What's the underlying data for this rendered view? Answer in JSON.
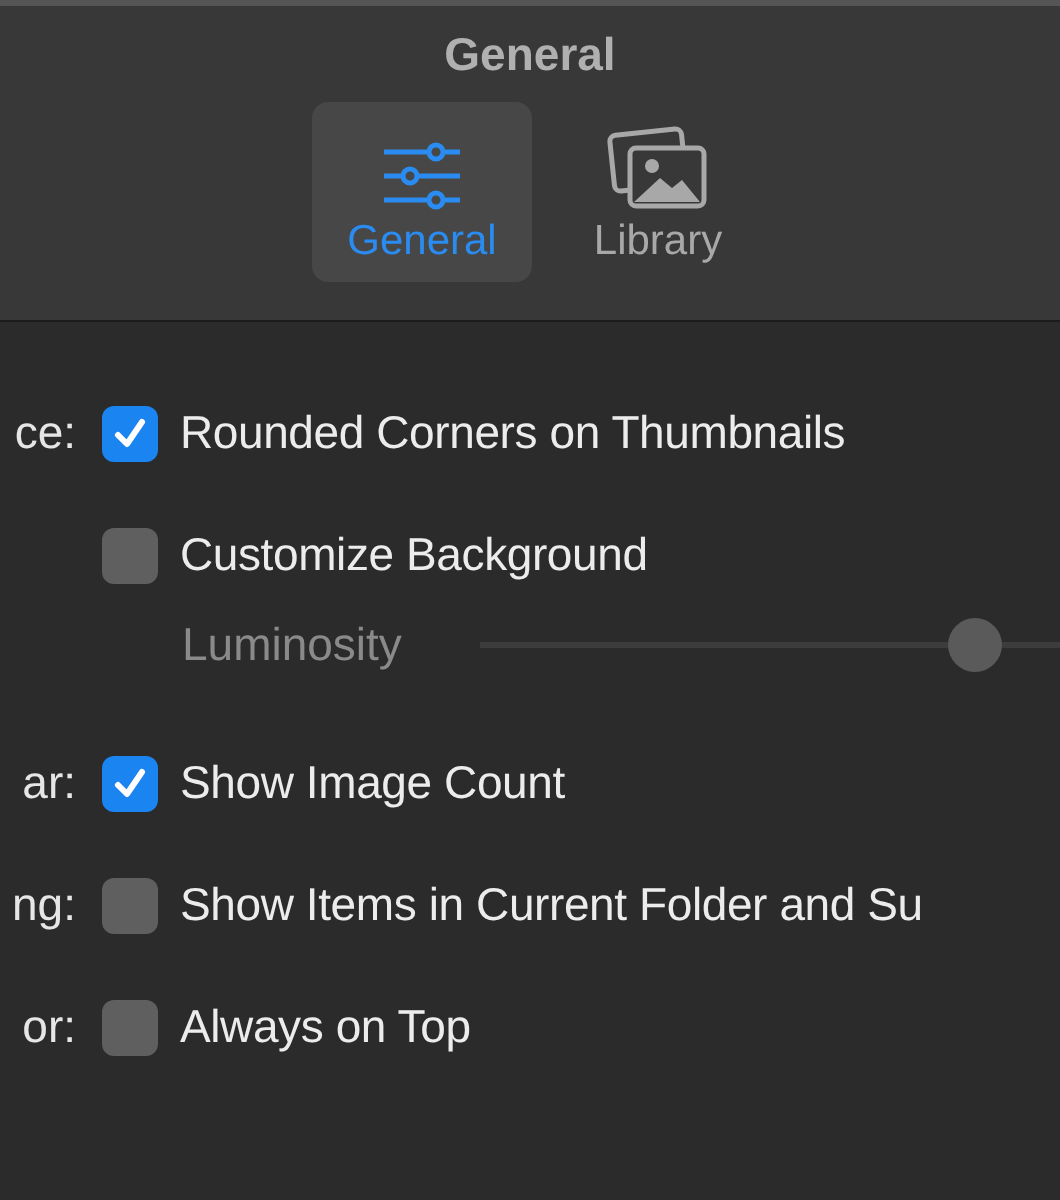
{
  "window": {
    "title": "General"
  },
  "tabs": [
    {
      "label": "General",
      "selected": true,
      "kind": "sliders"
    },
    {
      "label": "Library",
      "selected": false,
      "kind": "photos"
    }
  ],
  "rows": [
    {
      "kind": "checkbox",
      "section": "ce:",
      "label": "Rounded Corners on Thumbnails",
      "checked": true
    },
    {
      "kind": "checkbox",
      "label": "Customize Background",
      "checked": false
    },
    {
      "kind": "slider",
      "label": "Luminosity",
      "level": 0.89
    },
    {
      "kind": "checkbox",
      "section": "ar:",
      "label": "Show Image Count",
      "checked": true
    },
    {
      "kind": "checkbox",
      "section": "ng:",
      "label": "Show Items in Current Folder and Su",
      "checked": false
    },
    {
      "kind": "checkbox",
      "section": "or:",
      "label": "Always on Top",
      "checked": false
    }
  ]
}
